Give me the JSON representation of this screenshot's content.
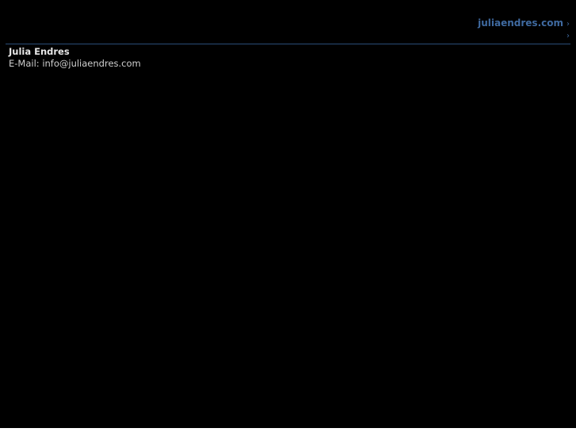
{
  "breadcrumb": {
    "items": [
      {
        "label": "juliaendres.com",
        "separator": "›"
      },
      {
        "label": "",
        "separator": "›"
      }
    ]
  },
  "contact": {
    "name": "Julia Endres",
    "email_label": "E-Mail:",
    "email": "info@juliaendres.com"
  },
  "colors": {
    "background": "#000000",
    "link": "#3f6aa0",
    "divider": "#2a4d78",
    "text": "#d7d7d7"
  }
}
